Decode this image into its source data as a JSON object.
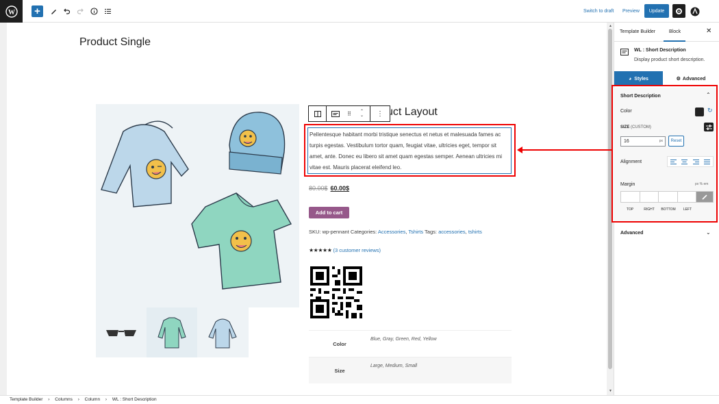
{
  "topbar": {
    "switch_to_draft": "Switch to draft",
    "preview": "Preview",
    "update": "Update"
  },
  "editor": {
    "page_title": "Product Single",
    "product_title": "uct Layout",
    "short_description": "Pellentesque habitant morbi tristique senectus et netus et malesuada fames ac turpis egestas. Vestibulum tortor quam, feugiat vitae, ultricies eget, tempor sit amet, ante. Donec eu libero sit amet quam egestas semper. Aenean ultricies mi vitae est. Mauris placerat eleifend leo.",
    "old_price": "80.00$",
    "new_price": "60.00$",
    "add_to_cart": "Add to cart",
    "meta": {
      "sku_label": "SKU: wp-pennant",
      "categories_label": "Categories:",
      "categories": [
        "Accessories",
        "Tshirts"
      ],
      "tags_label": "Tags:",
      "tags": [
        "accessories",
        "tshirts"
      ]
    },
    "reviews_link": "(3 customer reviews)",
    "stars": "★★★★★",
    "attributes": [
      {
        "key": "Color",
        "value": "Blue, Gray, Green, Red, Yellow"
      },
      {
        "key": "Size",
        "value": "Large, Medium, Small"
      }
    ]
  },
  "sidebar": {
    "tabs": [
      "Template Builder",
      "Block"
    ],
    "block_title": "WL : Short Description",
    "block_desc": "Display product short description.",
    "style_tabs": [
      "Styles",
      "Advanced"
    ],
    "panel_title": "Short Description",
    "color_label": "Color",
    "size_label": "SIZE",
    "size_custom": "(CUSTOM)",
    "size_value": "16",
    "size_unit": "px",
    "reset": "Reset",
    "alignment_label": "Alignment",
    "margin_label": "Margin",
    "margin_units": "px  %  em",
    "margin_sides": [
      "TOP",
      "RIGHT",
      "BOTTOM",
      "LEFT"
    ],
    "advanced_label": "Advanced",
    "color_value": "#222222"
  },
  "breadcrumbs": [
    "Template Builder",
    "Columns",
    "Column",
    "WL : Short Description"
  ]
}
